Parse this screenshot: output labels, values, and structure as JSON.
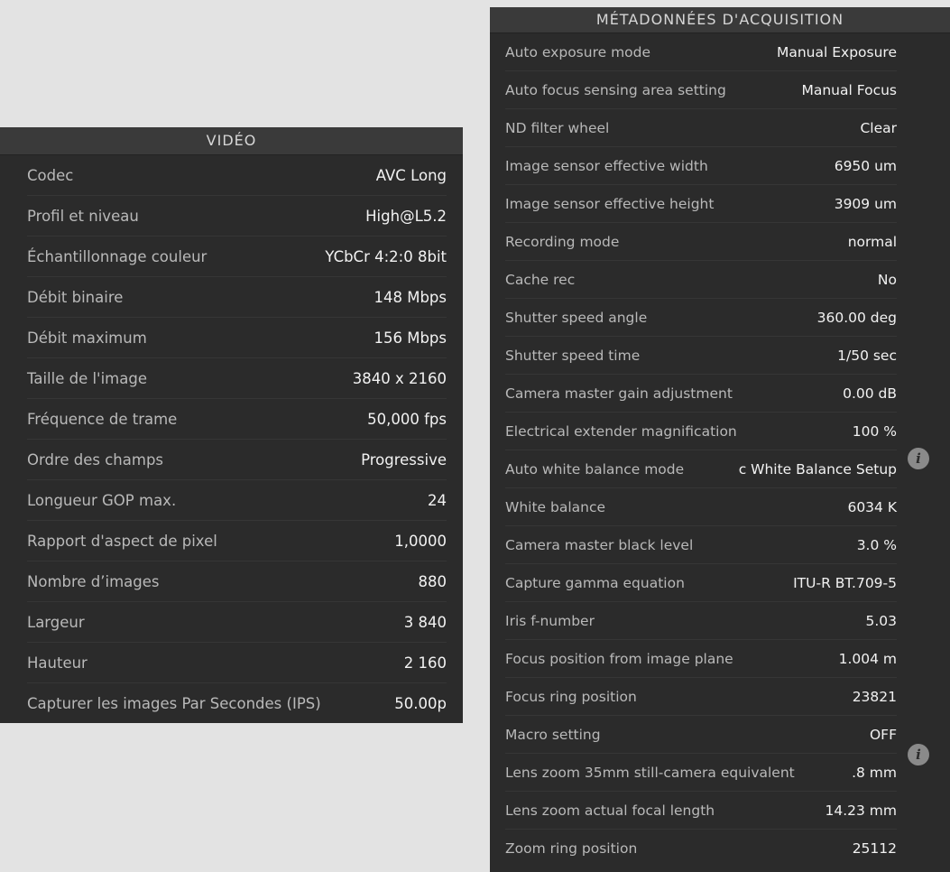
{
  "video": {
    "title": "VIDÉO",
    "rows": [
      {
        "label": "Codec",
        "value": "AVC Long"
      },
      {
        "label": "Profil et niveau",
        "value": "High@L5.2"
      },
      {
        "label": "Échantillonnage couleur",
        "value": "YCbCr 4:2:0 8bit"
      },
      {
        "label": "Débit binaire",
        "value": "148 Mbps"
      },
      {
        "label": "Débit maximum",
        "value": "156 Mbps"
      },
      {
        "label": "Taille de l'image",
        "value": "3840 x 2160"
      },
      {
        "label": "Fréquence de trame",
        "value": "50,000 fps"
      },
      {
        "label": "Ordre des champs",
        "value": "Progressive"
      },
      {
        "label": "Longueur GOP max.",
        "value": "24"
      },
      {
        "label": "Rapport d'aspect de pixel",
        "value": "1,0000"
      },
      {
        "label": "Nombre d’images",
        "value": "880"
      },
      {
        "label": "Largeur",
        "value": "3 840"
      },
      {
        "label": "Hauteur",
        "value": "2 160"
      },
      {
        "label": "Capturer les images Par Secondes (IPS)",
        "value": "50.00p"
      }
    ]
  },
  "acquisition": {
    "title": "MÉTADONNÉES D'ACQUISITION",
    "rows": [
      {
        "label": "Auto exposure mode",
        "value": "Manual Exposure"
      },
      {
        "label": "Auto focus sensing area setting",
        "value": "Manual Focus"
      },
      {
        "label": "ND filter wheel",
        "value": "Clear"
      },
      {
        "label": "Image sensor effective width",
        "value": "6950 um"
      },
      {
        "label": "Image sensor effective height",
        "value": "3909 um"
      },
      {
        "label": "Recording mode",
        "value": "normal"
      },
      {
        "label": "Cache rec",
        "value": "No"
      },
      {
        "label": "Shutter speed angle",
        "value": "360.00 deg"
      },
      {
        "label": "Shutter speed time",
        "value": "1/50 sec"
      },
      {
        "label": "Camera master gain adjustment",
        "value": "0.00 dB"
      },
      {
        "label": "Electrical extender magnification",
        "value": "100 %"
      },
      {
        "label": "Auto white balance mode",
        "value": "c White Balance Setup",
        "info": "i"
      },
      {
        "label": "White balance",
        "value": "6034 K"
      },
      {
        "label": "Camera master black level",
        "value": "3.0 %"
      },
      {
        "label": "Capture gamma equation",
        "value": "ITU-R BT.709-5"
      },
      {
        "label": "Iris f-number",
        "value": "5.03"
      },
      {
        "label": "Focus position from image plane",
        "value": "1.004 m"
      },
      {
        "label": "Focus ring position",
        "value": "23821"
      },
      {
        "label": "Macro setting",
        "value": "OFF"
      },
      {
        "label": "Lens zoom 35mm still-camera equivalent",
        "value": ".8 mm",
        "info": "i"
      },
      {
        "label": "Lens zoom actual focal length",
        "value": "14.23 mm"
      },
      {
        "label": "Zoom ring position",
        "value": "25112"
      }
    ]
  }
}
